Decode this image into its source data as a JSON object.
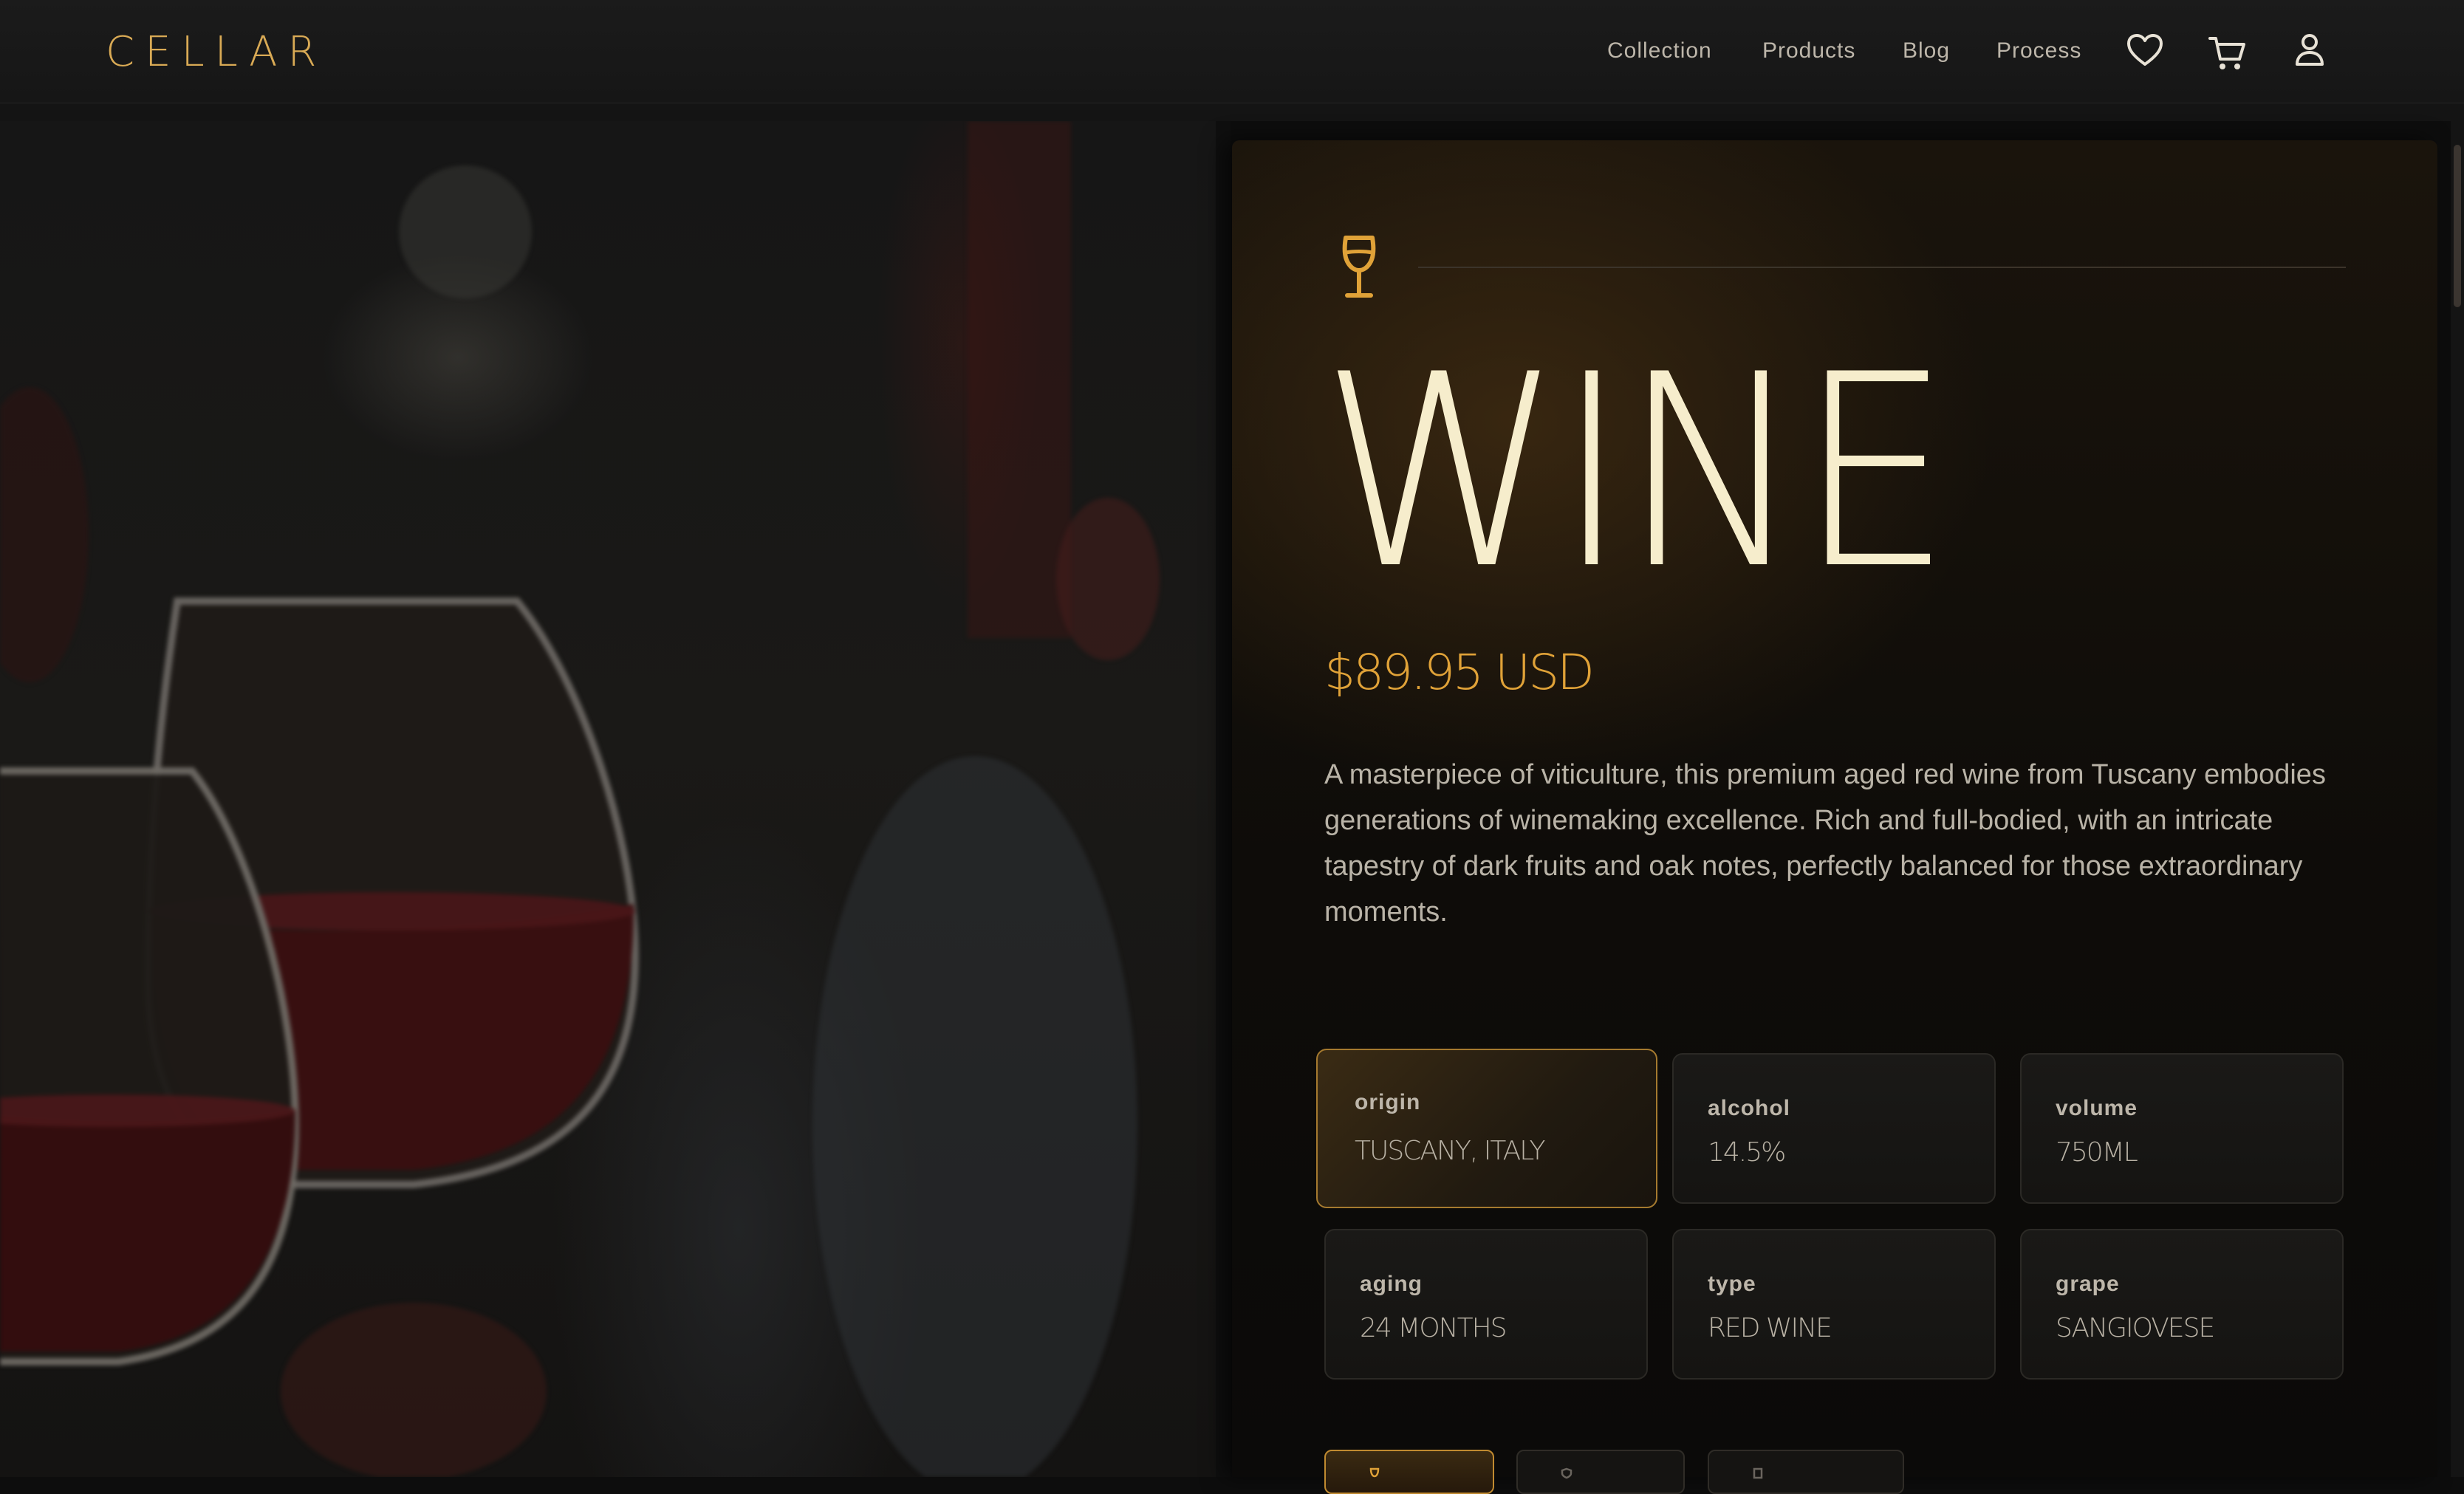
{
  "brand": {
    "logo": "CELLAR",
    "accent_color": "#d9aa55"
  },
  "nav": {
    "links": [
      "Collection",
      "Products",
      "Blog",
      "Process"
    ],
    "icons": [
      "heart-icon",
      "cart-icon",
      "user-icon"
    ]
  },
  "hero": {
    "image": "photo-blurred-red-wine-glasses"
  },
  "product": {
    "icon": "wine-glass-icon",
    "title": "WINE",
    "price": "$89.95 USD",
    "description": "A masterpiece of viticulture, this premium aged red wine from Tuscany embodies generations of winemaking excellence. Rich and full-bodied, with an intricate tapestry of dark fruits and oak notes, perfectly balanced for those extraordinary moments.",
    "specs": [
      {
        "label": "origin",
        "value": "TUSCANY, ITALY",
        "selected": true
      },
      {
        "label": "alcohol",
        "value": "14.5%",
        "selected": false
      },
      {
        "label": "volume",
        "value": "750ML",
        "selected": false
      },
      {
        "label": "aging",
        "value": "24 MONTHS",
        "selected": false
      },
      {
        "label": "type",
        "value": "RED WINE",
        "selected": false
      },
      {
        "label": "grape",
        "value": "SANGIOVESE",
        "selected": false
      }
    ],
    "tabs": [
      {
        "icon": "wine-glass-icon",
        "active": true
      },
      {
        "icon": "shield-icon",
        "active": false
      },
      {
        "icon": "document-icon",
        "active": false
      }
    ]
  },
  "colors": {
    "title": "#f6edcc",
    "price": "#e0a238",
    "panel_bg": "#0e0c09",
    "card_border_active": "#a57a2f"
  }
}
